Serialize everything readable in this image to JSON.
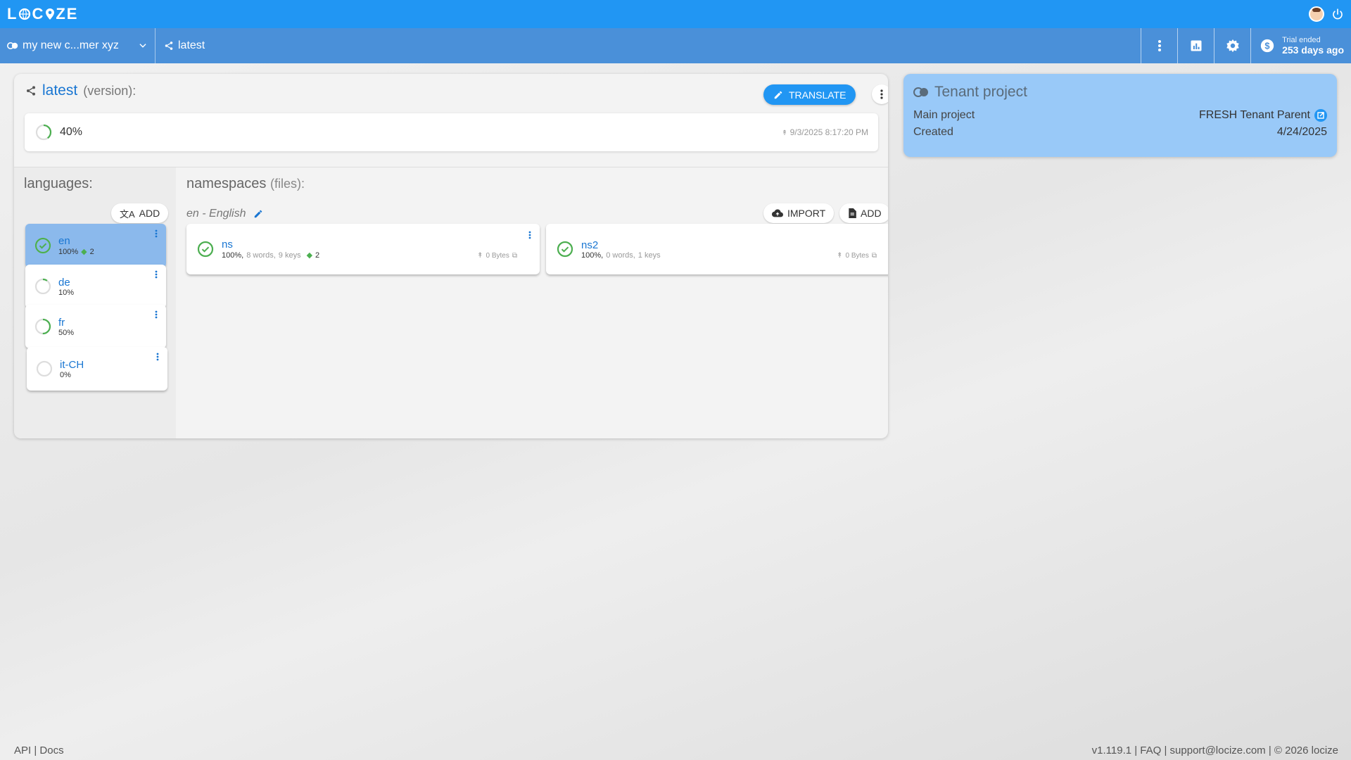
{
  "app": {
    "logo_text_left": "L",
    "logo_text_mid": "C",
    "logo_text_right": "ZE"
  },
  "subbar": {
    "project_name": "my new c...mer xyz",
    "version": "latest",
    "trial_label": "Trial ended",
    "trial_value": "253 days ago"
  },
  "version_card": {
    "title": "latest",
    "title_suffix": "(version):",
    "translate_label": "TRANSLATE",
    "progress": "40%",
    "progress_value": 0.4,
    "date": "9/3/2025 8:17:20 PM"
  },
  "languages": {
    "title": "languages:",
    "add_label": "ADD",
    "items": [
      {
        "code": "en",
        "pct": "100%",
        "branches": "2",
        "progress_value": 1.0
      },
      {
        "code": "de",
        "pct": "10%",
        "progress_value": 0.1
      },
      {
        "code": "fr",
        "pct": "50%",
        "progress_value": 0.5
      },
      {
        "code": "it-CH",
        "pct": "0%",
        "progress_value": 0.0
      }
    ]
  },
  "namespaces": {
    "title": "namespaces",
    "title_suffix": "(files):",
    "current_language": "en - English",
    "import_label": "IMPORT",
    "add_label": "ADD",
    "items": [
      {
        "name": "ns",
        "pct": "100%,",
        "words": "8 words,",
        "keys": "9 keys",
        "branches": "2",
        "bytes": "0 Bytes"
      },
      {
        "name": "ns2",
        "pct": "100%,",
        "words": "0 words,",
        "keys": "1 keys",
        "bytes": "0 Bytes"
      }
    ]
  },
  "tenant": {
    "title": "Tenant project",
    "main_project_label": "Main project",
    "main_project_value": "FRESH Tenant Parent",
    "created_label": "Created",
    "created_value": "4/24/2025"
  },
  "footer": {
    "left": "API | Docs",
    "right": "v1.119.1 | FAQ | support@locize.com | © 2026 locize"
  },
  "colors": {
    "primary": "#2196f3",
    "subbar": "#4a90d9",
    "progress_green": "#4caf50",
    "tenant_bg": "#99c9f8"
  }
}
